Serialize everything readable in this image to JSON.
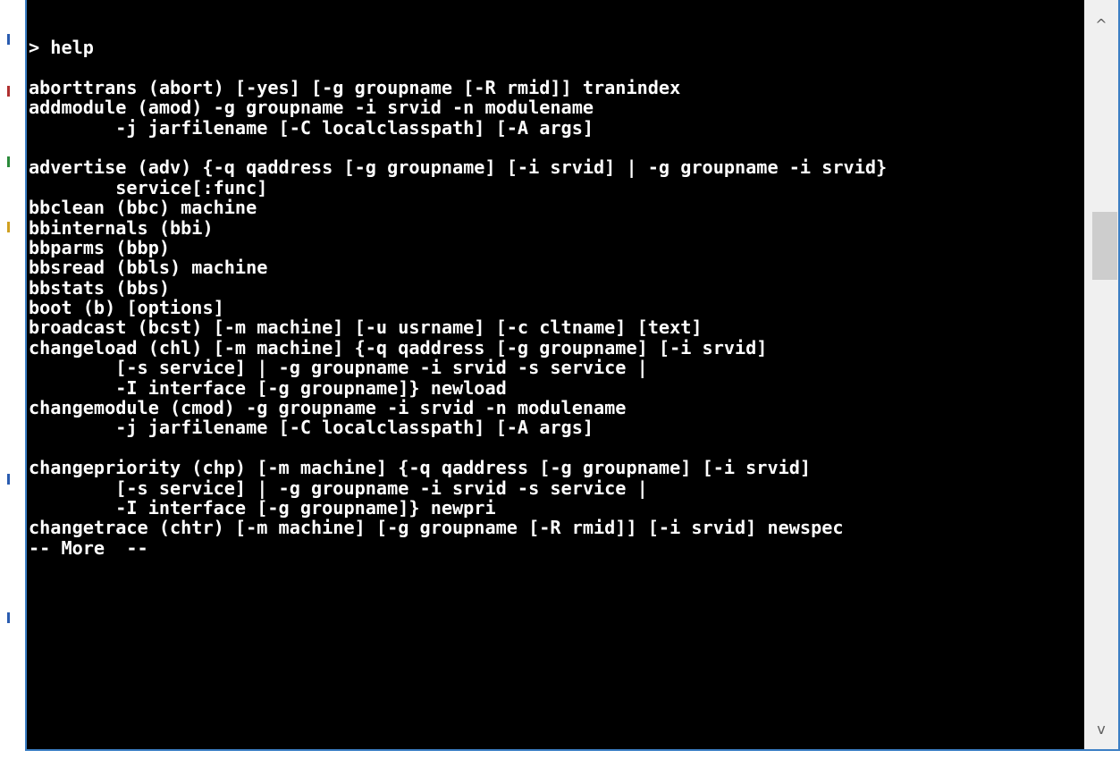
{
  "console": {
    "lines": [
      "> help",
      "",
      "aborttrans (abort) [-yes] [-g groupname [-R rmid]] tranindex",
      "addmodule (amod) -g groupname -i srvid -n modulename",
      "        -j jarfilename [-C localclasspath] [-A args]",
      "",
      "advertise (adv) {-q qaddress [-g groupname] [-i srvid] | -g groupname -i srvid}",
      "        service[:func]",
      "bbclean (bbc) machine",
      "bbinternals (bbi)",
      "bbparms (bbp)",
      "bbsread (bbls) machine",
      "bbstats (bbs)",
      "boot (b) [options]",
      "broadcast (bcst) [-m machine] [-u usrname] [-c cltname] [text]",
      "changeload (chl) [-m machine] {-q qaddress [-g groupname] [-i srvid]",
      "        [-s service] | -g groupname -i srvid -s service |",
      "        -I interface [-g groupname]} newload",
      "changemodule (cmod) -g groupname -i srvid -n modulename",
      "        -j jarfilename [-C localclasspath] [-A args]",
      "",
      "changepriority (chp) [-m machine] {-q qaddress [-g groupname] [-i srvid]",
      "        [-s service] | -g groupname -i srvid -s service |",
      "        -I interface [-g groupname]} newpri",
      "changetrace (chtr) [-m machine] [-g groupname [-R rmid]] [-i srvid] newspec",
      "-- More  --"
    ]
  },
  "scrollbar": {
    "up_icon": "chevron-up-icon",
    "down_icon": "chevron-down-icon",
    "up_glyph": "^",
    "down_glyph": "v"
  },
  "colors": {
    "console_background": "#000000",
    "console_text": "#ffffff",
    "window_border": "#3c7fc4",
    "scrollbar_track": "#f0f0f0",
    "scrollbar_thumb": "#cdcdcd"
  }
}
